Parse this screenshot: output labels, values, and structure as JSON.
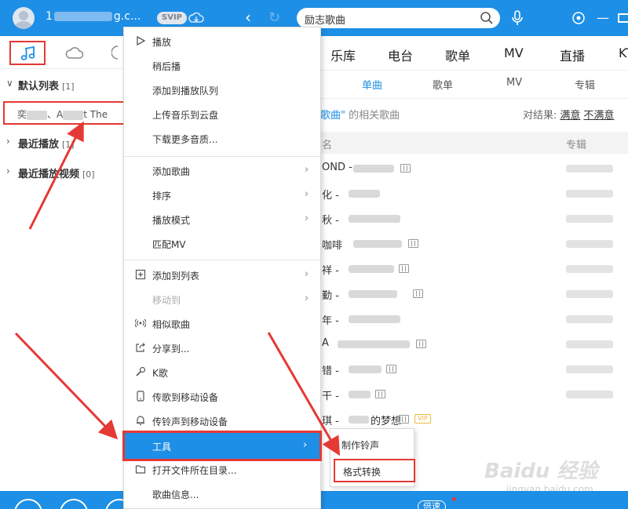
{
  "app": {
    "username": "1",
    "username_suffix": "g.c...",
    "svip_badge": "SVIP"
  },
  "search": {
    "value": "励志歌曲"
  },
  "left_panel": {
    "default_list": {
      "label": "默认列表",
      "count": "[1]"
    },
    "playing_item": {
      "prefix": "奕",
      "middle": "、A",
      "suffix": "t The"
    },
    "recent_play": {
      "label": "最近播放",
      "count": "[1]"
    },
    "recent_video": {
      "label": "最近播放视频",
      "count": "[0]"
    }
  },
  "main_tabs": [
    "乐库",
    "电台",
    "歌单",
    "MV",
    "直播",
    "KT"
  ],
  "sub_tabs": [
    "单曲",
    "歌单",
    "MV",
    "专辑"
  ],
  "results": {
    "keyword": "歌曲\"",
    "suffix": " 的相关歌曲",
    "feedback_label": "对结果:",
    "satisfied": "满意",
    "unsatisfied": "不满意"
  },
  "columns": {
    "name": "名",
    "album": "专辑"
  },
  "songs": [
    {
      "name": "OND -"
    },
    {
      "name": "化 -"
    },
    {
      "name": "秋 -"
    },
    {
      "name": "咖啡"
    },
    {
      "name": "祥 -"
    },
    {
      "name": "勤 -"
    },
    {
      "name": "年 -"
    },
    {
      "name": "A"
    },
    {
      "name": "错 -"
    },
    {
      "name": "干 -"
    },
    {
      "name": "琪 -",
      "extra": "的梦想",
      "vip": "VIP"
    }
  ],
  "context_menu": {
    "items": [
      {
        "label": "播放",
        "icon": "play-icon"
      },
      {
        "label": "稍后播"
      },
      {
        "label": "添加到播放队列"
      },
      {
        "label": "上传音乐到云盘"
      },
      {
        "label": "下载更多音质..."
      },
      {
        "label": "添加歌曲",
        "submenu": true
      },
      {
        "label": "排序",
        "submenu": true
      },
      {
        "label": "播放模式",
        "submenu": true
      },
      {
        "label": "匹配MV"
      },
      {
        "label": "添加到列表",
        "icon": "plus-box-icon",
        "submenu": true
      },
      {
        "label": "移动到",
        "disabled": true,
        "submenu": true
      },
      {
        "label": "相似歌曲",
        "icon": "radio-wave-icon"
      },
      {
        "label": "分享到...",
        "icon": "share-icon"
      },
      {
        "label": "K歌",
        "icon": "microphone-icon"
      },
      {
        "label": "传歌到移动设备",
        "icon": "phone-icon"
      },
      {
        "label": "传铃声到移动设备",
        "icon": "bell-icon"
      }
    ],
    "tools": {
      "label": "工具"
    },
    "after_tools": [
      {
        "label": "打开文件所在目录...",
        "icon": "folder-icon"
      },
      {
        "label": "歌曲信息..."
      }
    ]
  },
  "submenu": {
    "ringtone": "制作铃声",
    "convert": "格式转换"
  },
  "bottom": {
    "speed_label": "倍速"
  },
  "watermark": {
    "brand": "Baidu 经验",
    "url": "jingyan.baidu.com"
  },
  "colors": {
    "brand_blue": "#1e8fe6",
    "annotation_red": "#e53935"
  }
}
